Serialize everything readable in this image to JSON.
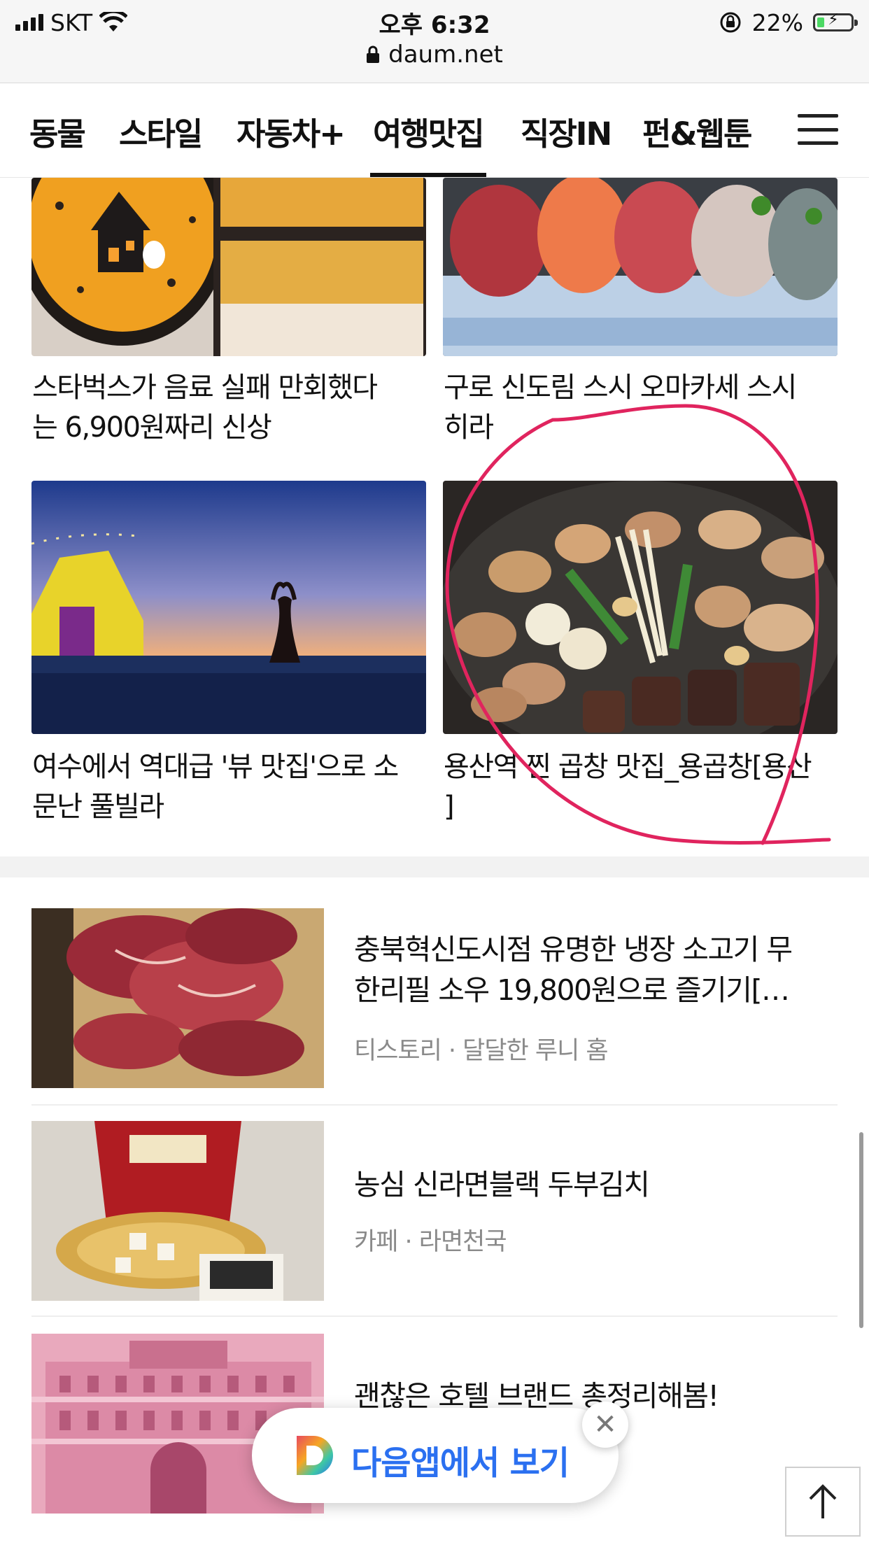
{
  "status_bar": {
    "carrier": "SKT",
    "time": "오후 6:32",
    "url": "daum.net",
    "battery": "22%",
    "battery_level": 0.22
  },
  "tabs": [
    {
      "label": "동물",
      "active": false
    },
    {
      "label": "스타일",
      "active": false
    },
    {
      "label": "자동차+",
      "active": false
    },
    {
      "label": "여행맛집",
      "active": true
    },
    {
      "label": "직장IN",
      "active": false
    },
    {
      "label": "펀&웹툰",
      "active": false
    }
  ],
  "grid": [
    {
      "title_line1": "스타벅스가 음료 실패 만회했다",
      "title_line2": "는 6,900원짜리 신상"
    },
    {
      "title_line1": "구로 신도림 스시 오마카세 스시",
      "title_line2": "히라"
    },
    {
      "title_line1": "여수에서 역대급 '뷰 맛집'으로 소",
      "title_line2": "문난 풀빌라"
    },
    {
      "title_line1": "용산역 찐 곱창 맛집_용곱창[용산",
      "title_line2": "]"
    }
  ],
  "list": [
    {
      "title_line1": "충북혁신도시점 유명한 냉장 소고기 무",
      "title_line2": "한리필 소우 19,800원으로 즐기기[…",
      "source": "티스토리 · 달달한 루니 홈"
    },
    {
      "title_line1": "농심 신라면블랙 두부김치",
      "title_line2": "",
      "source": "카페 · 라면천국"
    },
    {
      "title_line1": "괜찮은 호텔 브랜드 총정리해봄!",
      "title_line2": "",
      "source": ""
    }
  ],
  "app_banner": {
    "label": "다음앱에서 보기"
  },
  "colors": {
    "annotation": "#e0245e",
    "accent": "#2b70f0"
  }
}
